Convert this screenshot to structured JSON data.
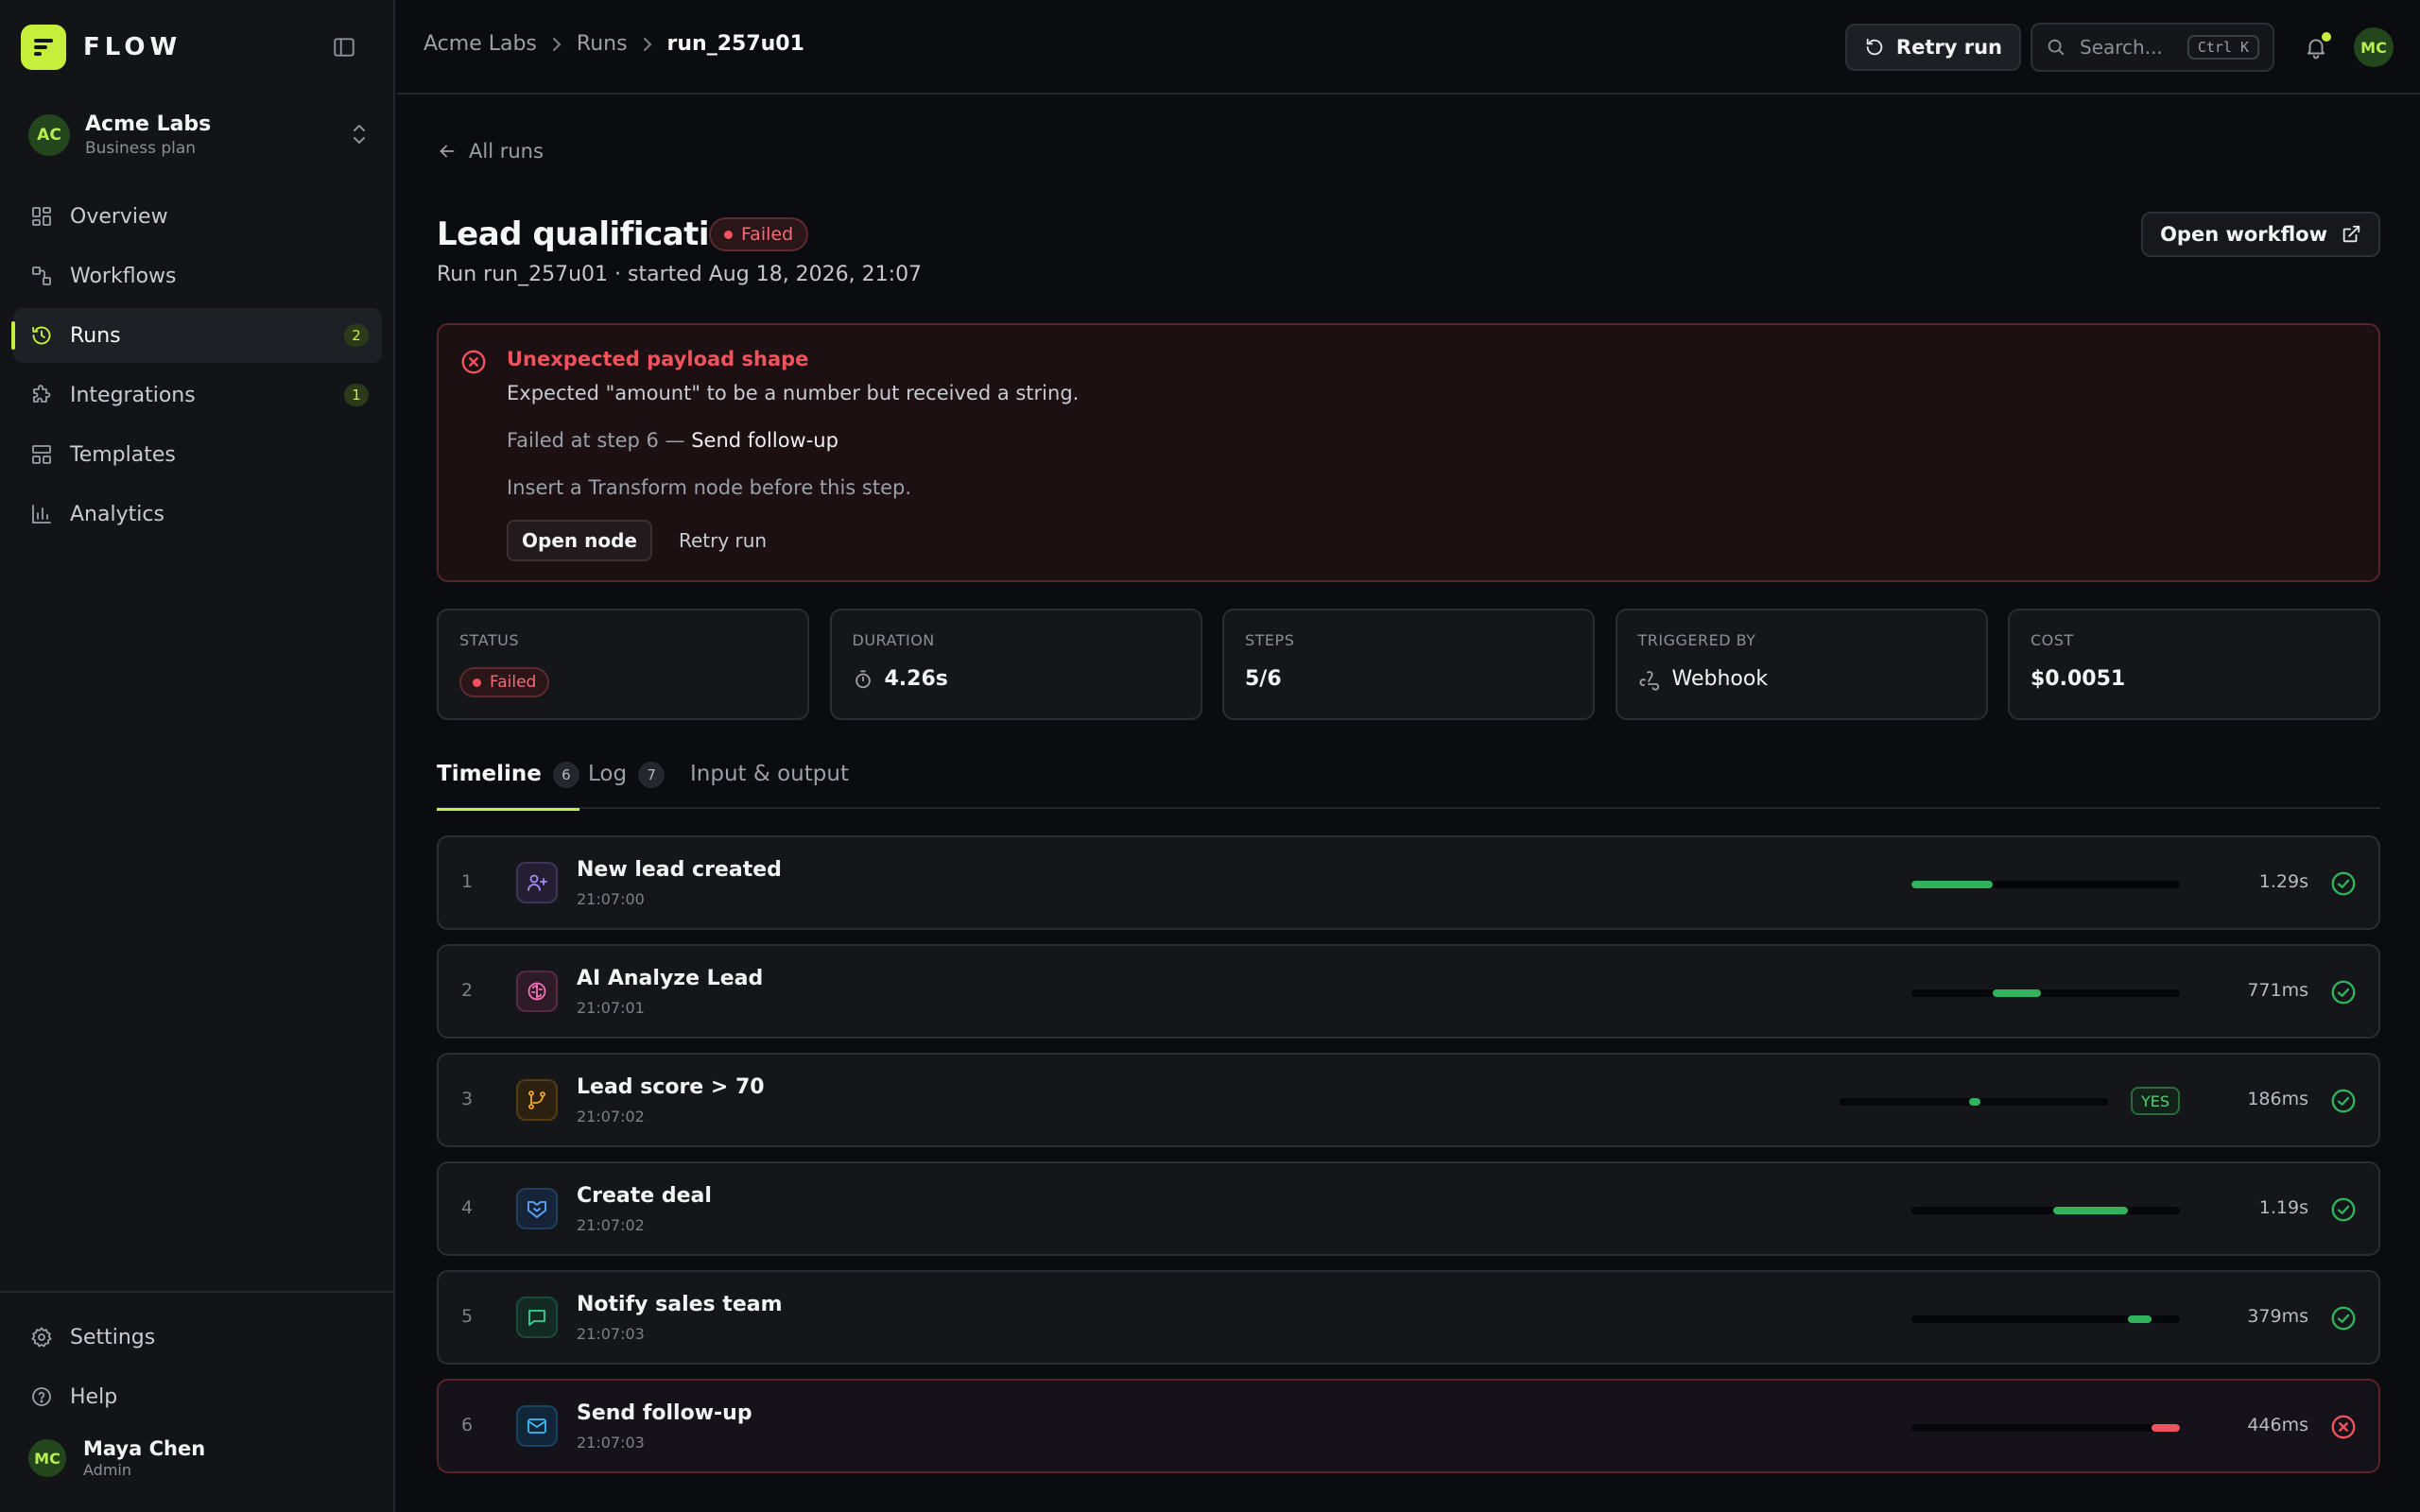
{
  "brand": {
    "name": "FLOW"
  },
  "workspace": {
    "initials": "AC",
    "name": "Acme Labs",
    "plan": "Business plan"
  },
  "nav": [
    {
      "label": "Overview",
      "icon": "grid-icon",
      "badge": ""
    },
    {
      "label": "Workflows",
      "icon": "workflow-icon",
      "badge": ""
    },
    {
      "label": "Runs",
      "icon": "history-icon",
      "badge": "2"
    },
    {
      "label": "Integrations",
      "icon": "puzzle-icon",
      "badge": "1"
    },
    {
      "label": "Templates",
      "icon": "template-icon",
      "badge": ""
    },
    {
      "label": "Analytics",
      "icon": "bar-chart-icon",
      "badge": ""
    }
  ],
  "bottom_nav": [
    {
      "label": "Settings",
      "icon": "gear-icon"
    },
    {
      "label": "Help",
      "icon": "help-icon"
    }
  ],
  "user": {
    "initials": "MC",
    "name": "Maya Chen",
    "role": "Admin"
  },
  "breadcrumb": [
    "Acme Labs",
    "Runs",
    "run_257u01"
  ],
  "topbar": {
    "retry_label": "Retry run",
    "search_placeholder": "Search...",
    "search_shortcut": "Ctrl K",
    "avatar": "MC"
  },
  "page": {
    "back_label": "All runs",
    "title": "Lead qualification",
    "status": "Failed",
    "subtitle": "Run run_257u01 · started Aug 18, 2026, 21:07",
    "open_workflow_label": "Open workflow"
  },
  "alert": {
    "title": "Unexpected payload shape",
    "message": "Expected \"amount\" to be a number but received a string.",
    "failed_prefix": "Failed at step 6 —",
    "failed_node": "Send follow-up",
    "hint": "Insert a Transform node before this step.",
    "open_node_label": "Open node",
    "retry_label": "Retry run"
  },
  "stats": {
    "status": {
      "label": "STATUS",
      "value": "Failed"
    },
    "duration": {
      "label": "DURATION",
      "value": "4.26s"
    },
    "steps": {
      "label": "STEPS",
      "value": "5/6"
    },
    "trigger": {
      "label": "TRIGGERED BY",
      "value": "Webhook"
    },
    "cost": {
      "label": "COST",
      "value": "$0.0051"
    }
  },
  "tabs": [
    {
      "label": "Timeline",
      "count": "6"
    },
    {
      "label": "Log",
      "count": "7"
    },
    {
      "label": "Input & output",
      "count": ""
    }
  ],
  "colors": {
    "accent": "#c6ef3c",
    "success": "#2fb35c",
    "error": "#f0525e"
  },
  "steps": [
    {
      "num": "1",
      "name": "New lead created",
      "time": "21:07:00",
      "duration": "1.29s",
      "status": "success",
      "icon": "user-plus-icon",
      "icon_color": "#a78bfa",
      "icon_bg": "#241e33",
      "bar_start": 0,
      "bar_end": 0.303,
      "branch": ""
    },
    {
      "num": "2",
      "name": "AI Analyze Lead",
      "time": "21:07:01",
      "duration": "771ms",
      "status": "success",
      "icon": "brain-icon",
      "icon_color": "#f472b6",
      "icon_bg": "#2f1a27",
      "bar_start": 0.303,
      "bar_end": 0.484,
      "branch": ""
    },
    {
      "num": "3",
      "name": "Lead score > 70",
      "time": "21:07:02",
      "duration": "186ms",
      "status": "success",
      "icon": "branch-icon",
      "icon_color": "#f5a524",
      "icon_bg": "#2d2212",
      "bar_start": 0.484,
      "bar_end": 0.528,
      "branch": "YES"
    },
    {
      "num": "4",
      "name": "Create deal",
      "time": "21:07:02",
      "duration": "1.19s",
      "status": "success",
      "icon": "handshake-icon",
      "icon_color": "#60a5fa",
      "icon_bg": "#152437",
      "bar_start": 0.528,
      "bar_end": 0.807,
      "branch": ""
    },
    {
      "num": "5",
      "name": "Notify sales team",
      "time": "21:07:03",
      "duration": "379ms",
      "status": "success",
      "icon": "message-icon",
      "icon_color": "#34d399",
      "icon_bg": "#122a21",
      "bar_start": 0.807,
      "bar_end": 0.896,
      "branch": ""
    },
    {
      "num": "6",
      "name": "Send follow-up",
      "time": "21:07:03",
      "duration": "446ms",
      "status": "failed",
      "icon": "mail-icon",
      "icon_color": "#38bdf8",
      "icon_bg": "#12263a",
      "bar_start": 0.896,
      "bar_end": 1.0,
      "branch": ""
    }
  ]
}
